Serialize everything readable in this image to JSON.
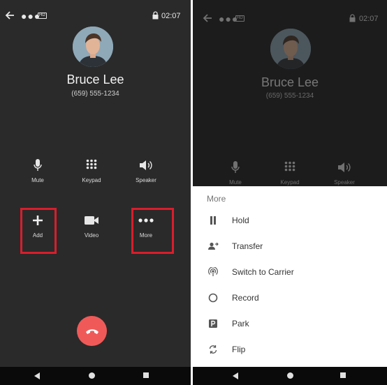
{
  "left_screen": {
    "status": {
      "time": "02:07",
      "hd_badge": "HD"
    },
    "caller": {
      "name": "Bruce Lee",
      "number": "(659) 555-1234"
    },
    "controls_row1": [
      {
        "label": "Mute",
        "icon": "microphone-icon"
      },
      {
        "label": "Keypad",
        "icon": "keypad-icon"
      },
      {
        "label": "Speaker",
        "icon": "speaker-icon"
      }
    ],
    "controls_row2": [
      {
        "label": "Add",
        "icon": "plus-icon",
        "highlighted": true
      },
      {
        "label": "Video",
        "icon": "video-camera-icon",
        "highlighted": false
      },
      {
        "label": "More",
        "icon": "more-dots-icon",
        "highlighted": true
      }
    ],
    "highlight_color": "#d81e2c",
    "end_call_color": "#ef5a58"
  },
  "right_screen": {
    "status": {
      "time": "02:07",
      "hd_badge": "HD"
    },
    "caller": {
      "name": "Bruce Lee",
      "number": "(659) 555-1234"
    },
    "controls_row1": [
      {
        "label": "Mute",
        "icon": "microphone-icon"
      },
      {
        "label": "Keypad",
        "icon": "keypad-icon"
      },
      {
        "label": "Speaker",
        "icon": "speaker-icon"
      }
    ],
    "more_menu": {
      "title": "More",
      "items": [
        {
          "label": "Hold",
          "icon": "pause-icon"
        },
        {
          "label": "Transfer",
          "icon": "transfer-icon"
        },
        {
          "label": "Switch to Carrier",
          "icon": "switch-carrier-icon"
        },
        {
          "label": "Record",
          "icon": "record-icon"
        },
        {
          "label": "Park",
          "icon": "park-icon"
        },
        {
          "label": "Flip",
          "icon": "flip-icon"
        }
      ]
    }
  }
}
